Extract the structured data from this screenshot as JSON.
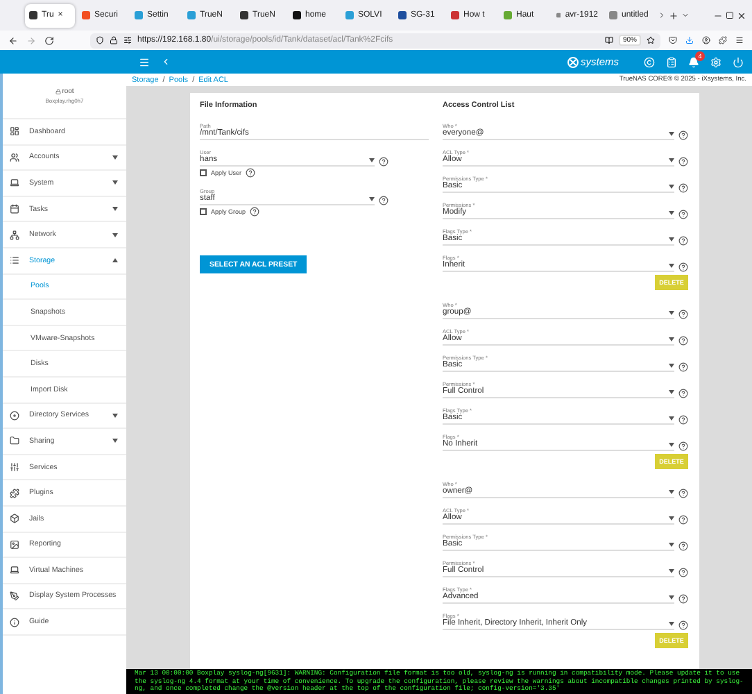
{
  "browser": {
    "tabs": [
      {
        "label": "Tru",
        "selected": true
      },
      {
        "label": "Securi",
        "selected": false
      },
      {
        "label": "Settin",
        "selected": false
      },
      {
        "label": "TrueN",
        "selected": false
      },
      {
        "label": "TrueN",
        "selected": false
      },
      {
        "label": "home",
        "selected": false
      },
      {
        "label": "SOLVI",
        "selected": false
      },
      {
        "label": "SG-31",
        "selected": false
      },
      {
        "label": "How t",
        "selected": false
      },
      {
        "label": "Haut",
        "selected": false
      },
      {
        "label": "avr-1912",
        "selected": false
      },
      {
        "label": "untitled",
        "selected": false
      }
    ],
    "close_tab": "×",
    "url_host": "https://192.168.1.80",
    "url_path": "/ui/storage/pools/id/Tank/dataset/acl/Tank%2Fcifs",
    "zoom": "90%"
  },
  "header": {
    "logo": "systems",
    "notifications": "4"
  },
  "breadcrumb": {
    "items": [
      "Storage",
      "Pools",
      "Edit ACL"
    ],
    "separator": "/",
    "copyright": "TrueNAS CORE® © 2025 - iXsystems, Inc."
  },
  "user": {
    "name": "root",
    "host": "Boxplay.rhg0h7"
  },
  "sidebar": [
    {
      "label": "Dashboard",
      "selected": false
    },
    {
      "label": "Accounts",
      "selected": false,
      "expanded": false
    },
    {
      "label": "System",
      "selected": false,
      "expanded": false
    },
    {
      "label": "Tasks",
      "selected": false,
      "expanded": false
    },
    {
      "label": "Network",
      "selected": false,
      "expanded": false
    },
    {
      "label": "Storage",
      "selected": true,
      "expanded": true,
      "children": [
        {
          "label": "Pools",
          "selected": true
        },
        {
          "label": "Snapshots",
          "selected": false
        },
        {
          "label": "VMware-Snapshots",
          "selected": false
        },
        {
          "label": "Disks",
          "selected": false
        },
        {
          "label": "Import Disk",
          "selected": false
        }
      ]
    },
    {
      "label": "Directory Services",
      "selected": false,
      "expanded": false
    },
    {
      "label": "Sharing",
      "selected": false,
      "expanded": false
    },
    {
      "label": "Services",
      "selected": false
    },
    {
      "label": "Plugins",
      "selected": false
    },
    {
      "label": "Jails",
      "selected": false
    },
    {
      "label": "Reporting",
      "selected": false
    },
    {
      "label": "Virtual Machines",
      "selected": false
    },
    {
      "label": "Display System Processes",
      "selected": false
    },
    {
      "label": "Guide",
      "selected": false
    }
  ],
  "file_information": {
    "title": "File Information",
    "path": {
      "label": "Path",
      "value": "/mnt/Tank/cifs"
    },
    "user": {
      "label": "User",
      "value": "hans"
    },
    "apply_user": {
      "label": "Apply User",
      "checked": false
    },
    "group": {
      "label": "Group",
      "value": "staff"
    },
    "apply_group": {
      "label": "Apply Group",
      "checked": false
    },
    "preset_button": "SELECT AN ACL PRESET"
  },
  "acl": {
    "title": "Access Control List",
    "entries": [
      {
        "fields": [
          {
            "label": "Who *",
            "value": "everyone@"
          },
          {
            "label": "ACL Type *",
            "value": "Allow"
          },
          {
            "label": "Permissions Type *",
            "value": "Basic"
          },
          {
            "label": "Permissions *",
            "value": "Modify"
          },
          {
            "label": "Flags Type *",
            "value": "Basic"
          },
          {
            "label": "Flags *",
            "value": "Inherit"
          }
        ],
        "delete_label": "DELETE"
      },
      {
        "fields": [
          {
            "label": "Who *",
            "value": "group@"
          },
          {
            "label": "ACL Type *",
            "value": "Allow"
          },
          {
            "label": "Permissions Type *",
            "value": "Basic"
          },
          {
            "label": "Permissions *",
            "value": "Full Control"
          },
          {
            "label": "Flags Type *",
            "value": "Basic"
          },
          {
            "label": "Flags *",
            "value": "No Inherit"
          }
        ],
        "delete_label": "DELETE"
      },
      {
        "fields": [
          {
            "label": "Who *",
            "value": "owner@"
          },
          {
            "label": "ACL Type *",
            "value": "Allow"
          },
          {
            "label": "Permissions Type *",
            "value": "Basic"
          },
          {
            "label": "Permissions *",
            "value": "Full Control"
          },
          {
            "label": "Flags Type *",
            "value": "Advanced"
          },
          {
            "label": "Flags *",
            "value": "File Inherit, Directory Inherit, Inherit Only"
          }
        ],
        "delete_label": "DELETE"
      }
    ]
  },
  "console": "Mar 13 00:00:00 Boxplay syslog-ng[9631]: WARNING: Configuration file format is too old, syslog-ng is running in compatibility mode. Please update it to use the syslog-ng 4.4 format at your time of convenience. To upgrade the configuration, please review the warnings about incompatible changes printed by syslog-ng, and once completed change the @version header at the top of the configuration file; config-version='3.35'"
}
